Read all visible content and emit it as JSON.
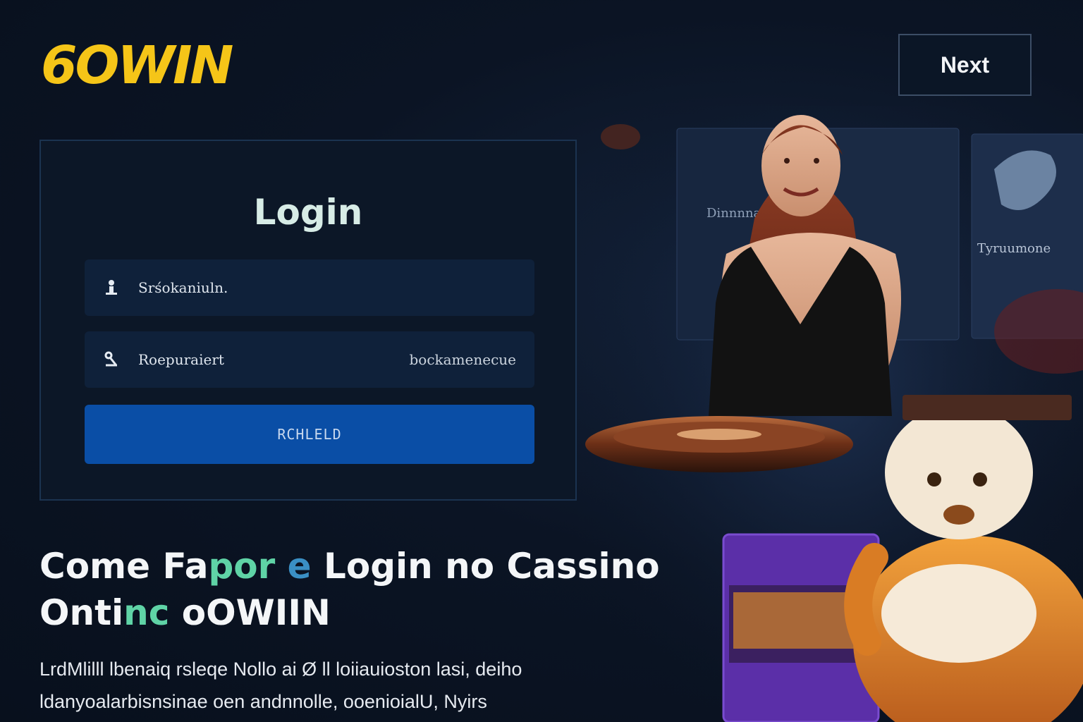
{
  "header": {
    "logo_text": "6OWIN",
    "next_label": "Next"
  },
  "login": {
    "title": "Login",
    "username_value": "Srśokaniuln.",
    "password_value": "Roepuraiert",
    "password_link": "bockamenecue",
    "submit_label": "RCHLELD"
  },
  "headline": {
    "part1": "Come Fa",
    "accent1": "por",
    "part2": " ",
    "accent2": "e",
    "part3": " Login no Cassino",
    "part4_start": "Onti",
    "accent3": "nc",
    "part4_end": " oOWIIN"
  },
  "body": {
    "line1": "LrdMlilll  lbenaiq rsleqe  Nollo ai Ø ll loiiauioston lasi,  deiho",
    "line2": "ldanyoalarbisnsinae oen andnnolle, ooenioialU, Nyirs"
  },
  "hero_cards": {
    "card1_label": "Dinnnnaine",
    "card2_label": "Tyruumone"
  },
  "colors": {
    "brand_yellow": "#f5c518",
    "button_blue": "#0a4ea6",
    "accent_green": "#5fd3a6",
    "background": "#0b1424"
  },
  "icons": {
    "username": "user-icon",
    "password": "key-icon"
  }
}
